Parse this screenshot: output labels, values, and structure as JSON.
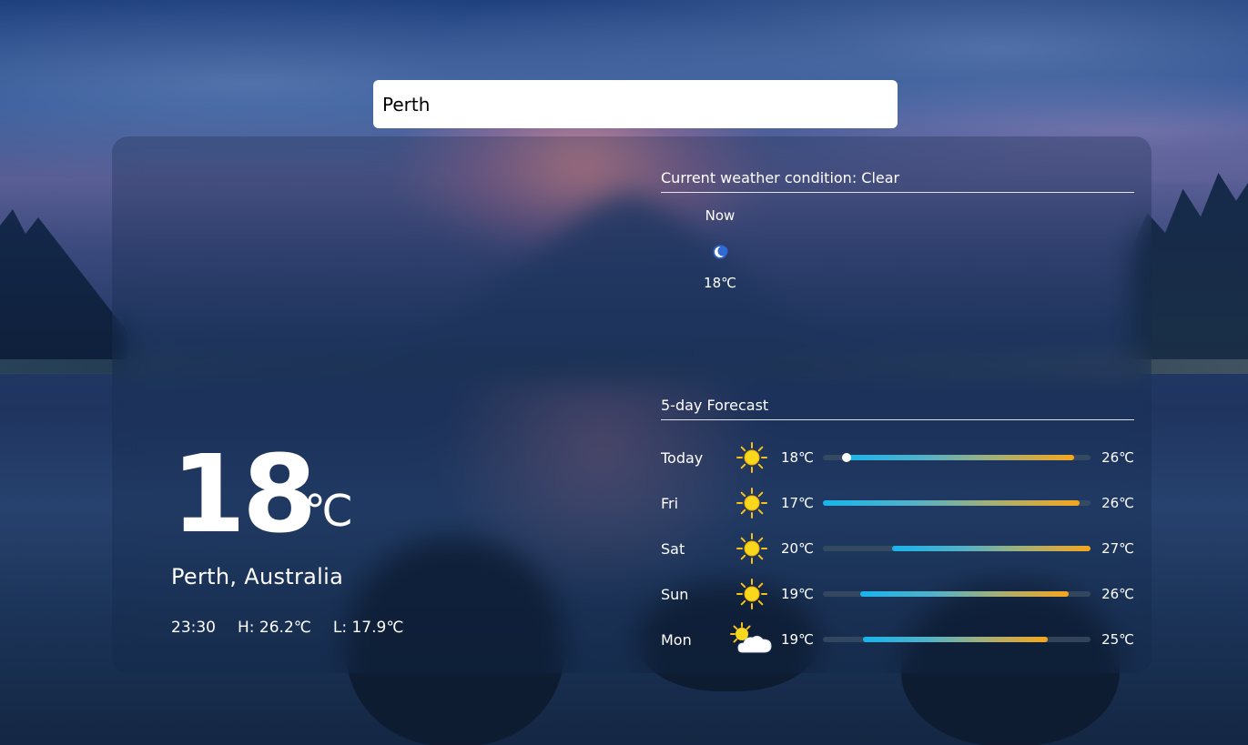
{
  "search": {
    "value": "Perth"
  },
  "current": {
    "temp": "18",
    "unit": "℃",
    "location": "Perth, Australia",
    "time": "23:30",
    "high": "H: 26.2℃",
    "low": "L: 17.9℃"
  },
  "condition": {
    "title": "Current weather condition: Clear"
  },
  "hourly": [
    {
      "label": "Now",
      "icon": "moon-icon",
      "temp": "18℃"
    }
  ],
  "forecast": {
    "title": "5-day Forecast",
    "scale": {
      "min": 17,
      "max": 27
    },
    "days": [
      {
        "day": "Today",
        "icon": "sun-icon",
        "low": "18℃",
        "high": "26℃",
        "fill_start": 0.07,
        "fill_end": 0.94,
        "current_marker": 0.09
      },
      {
        "day": "Fri",
        "icon": "sun-icon",
        "low": "17℃",
        "high": "26℃",
        "fill_start": 0.0,
        "fill_end": 0.96
      },
      {
        "day": "Sat",
        "icon": "sun-icon",
        "low": "20℃",
        "high": "27℃",
        "fill_start": 0.26,
        "fill_end": 1.0
      },
      {
        "day": "Sun",
        "icon": "sun-icon",
        "low": "19℃",
        "high": "26℃",
        "fill_start": 0.14,
        "fill_end": 0.92
      },
      {
        "day": "Mon",
        "icon": "partly-cloudy-icon",
        "low": "19℃",
        "high": "25℃",
        "fill_start": 0.15,
        "fill_end": 0.84
      }
    ]
  },
  "colors": {
    "bar_track": "#3c5064",
    "gradient_cold": "#1ab4ea",
    "gradient_warm": "#f6a61e",
    "sun": "#f7c21a",
    "moon_glow": "#2f6bd6"
  }
}
